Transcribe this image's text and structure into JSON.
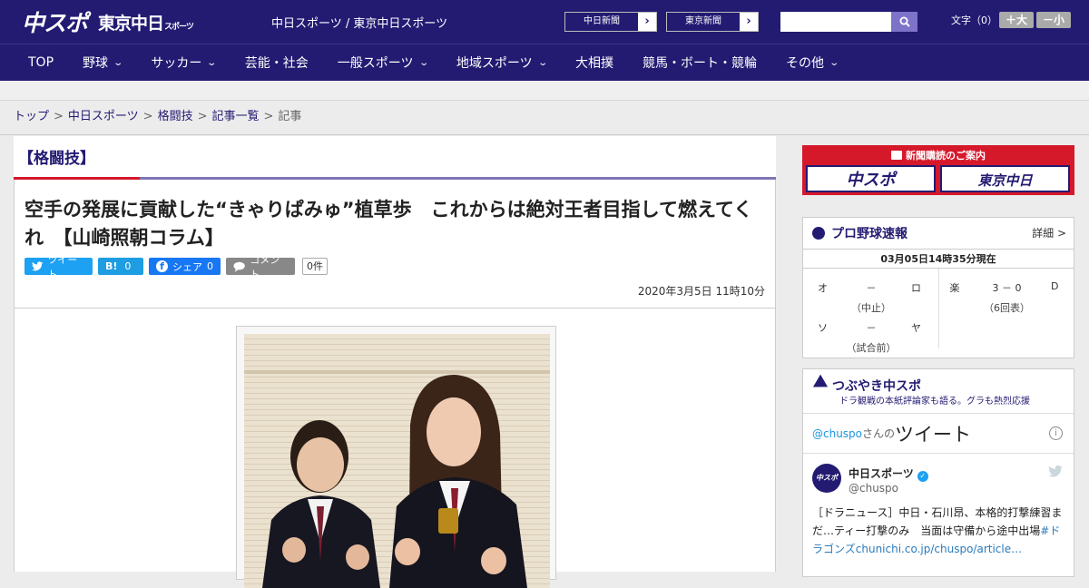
{
  "header": {
    "logo_main": "中スポ",
    "logo_sub": "東京中日",
    "logo_sub_small": "スポーツ",
    "site_name": "中日スポーツ / 東京中日スポーツ",
    "paper_buttons": [
      {
        "label": "中日新聞",
        "arrow": "›"
      },
      {
        "label": "東京新聞",
        "arrow": "›"
      }
    ],
    "search_placeholder": "",
    "font_label": "文字（0）",
    "font_larger": "＋大",
    "font_smaller": "－小"
  },
  "nav": {
    "items": [
      {
        "label": "TOP",
        "dropdown": false
      },
      {
        "label": "野球",
        "dropdown": true
      },
      {
        "label": "サッカー",
        "dropdown": true
      },
      {
        "label": "芸能・社会",
        "dropdown": false
      },
      {
        "label": "一般スポーツ",
        "dropdown": true
      },
      {
        "label": "地域スポーツ",
        "dropdown": true
      },
      {
        "label": "大相撲",
        "dropdown": false
      },
      {
        "label": "競馬・ボート・競輪",
        "dropdown": false
      },
      {
        "label": "その他",
        "dropdown": true
      }
    ]
  },
  "breadcrumb": {
    "items": [
      "トップ",
      "中日スポーツ",
      "格闘技",
      "記事一覧"
    ],
    "current": "記事",
    "separator": ">"
  },
  "article": {
    "category": "【格闘技】",
    "title": "空手の発展に貢献した“きゃりぱみゅ”植草歩　これからは絶対王者目指して燃えてくれ　【山崎照朝コラム】",
    "date": "2020年3月5日 11時10分",
    "social": {
      "tweet": "ツイート",
      "hatena_label": "B!",
      "hatena_count": "0",
      "facebook": "シェア",
      "facebook_count": "0",
      "comment": "コメント",
      "comment_count": "0件"
    }
  },
  "sidebar": {
    "subscribe": {
      "title": "新聞購読のご案内",
      "left": "中スポ",
      "right": "東京中日"
    },
    "baseball": {
      "title": "プロ野球速報",
      "more": "詳細 >",
      "updated": "03月05日14時35分現在",
      "games": [
        {
          "home": "オ",
          "score": "－",
          "away": "ロ",
          "status": "（中止）"
        },
        {
          "home": "楽",
          "score": "3 － 0",
          "away": "D",
          "status": "（6回表）"
        },
        {
          "home": "ソ",
          "score": "－",
          "away": "ヤ",
          "status": "（試合前）"
        }
      ]
    },
    "twitter": {
      "title": "つぶやき中スポ",
      "subtitle": "ドラ観戦の本紙評論家も語る。グラも熱烈応援",
      "handle_link": "@chuspo",
      "handle_suffix": "さんの",
      "tweets_word": "ツイート",
      "tweet": {
        "name": "中日スポーツ",
        "handle": "@chuspo",
        "avatar": "中スポ",
        "text": "［ドラニュース］中日・石川昂、本格的打撃練習まだ…ティー打撃のみ　当面は守備から途中出場",
        "link": "#ドラゴンズchunichi.co.jp/chuspo/article…"
      }
    }
  }
}
